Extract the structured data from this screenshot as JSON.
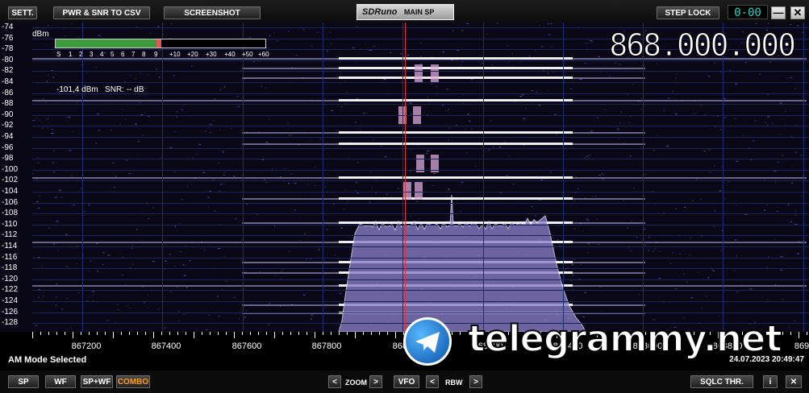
{
  "topbar": {
    "sett_label": "SETT.",
    "csv_label": "PWR & SNR TO CSV",
    "screenshot_label": "SCREENSHOT",
    "logo_brand": "SDRuno",
    "logo_name": "MAIN SP",
    "step_lock_label": "STEP LOCK",
    "digits": "0-00",
    "minimize_label": "—",
    "close_label": "✕"
  },
  "plot": {
    "frequency": "868.000.000",
    "meter_unit": "dBm",
    "meter_level": 0.48,
    "meter_scale": [
      "S",
      "1",
      "2",
      "3",
      "4",
      "5",
      "6",
      "7",
      "8",
      "9",
      "+10",
      "+20",
      "+30",
      "+40",
      "+50",
      "+60"
    ],
    "readout_power": "-101,4 dBm",
    "readout_snr": "SNR: -- dB",
    "y_labels": [
      "-74",
      "-76",
      "-78",
      "-80",
      "-82",
      "-84",
      "-86",
      "-88",
      "-90",
      "-92",
      "-94",
      "-96",
      "-98",
      "-100",
      "-102",
      "-104",
      "-106",
      "-108",
      "-110",
      "-112",
      "-114",
      "-116",
      "-118",
      "-120",
      "-122",
      "-124",
      "-126",
      "-128"
    ],
    "x_labels": [
      "867200",
      "867400",
      "867600",
      "867800",
      "868000",
      "868200",
      "868400",
      "868600",
      "868800",
      "869"
    ]
  },
  "status": {
    "mode": "AM Mode Selected",
    "datetime": "24.07.2023 20:49:47"
  },
  "bottombar": {
    "sp": "SP",
    "wf": "WF",
    "spwf": "SP+WF",
    "combo": "COMBO",
    "zoom_left": "<",
    "zoom_label": "ZOOM",
    "zoom_right": ">",
    "vfo": "VFO",
    "rbw_left": "<",
    "rbw_label": "RBW",
    "rbw_right": ">",
    "sqlc": "SQLC THR.",
    "info": "i",
    "close": "✕"
  },
  "watermark": {
    "text": "telegrammy.net"
  },
  "colors": {
    "accent": "#ff9a1a",
    "digits": "#1fd4c4",
    "marker": "#e03030",
    "spectrum": "#9b8ed4"
  }
}
